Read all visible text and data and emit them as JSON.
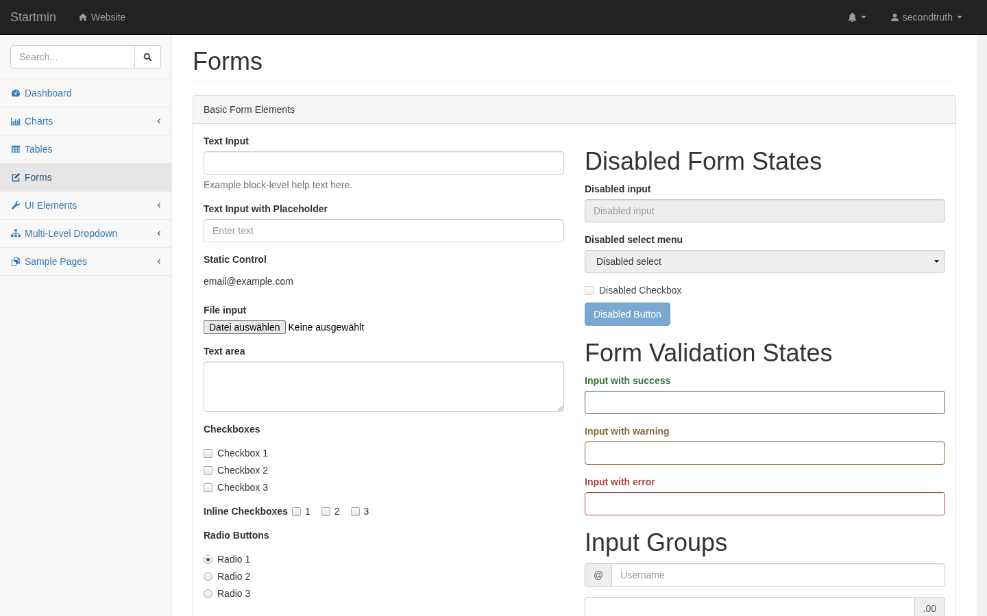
{
  "navbar": {
    "brand": "Startmin",
    "links": [
      {
        "label": "Website"
      }
    ],
    "user": {
      "name": "secondtruth"
    }
  },
  "sidebar": {
    "search": {
      "placeholder": "Search..."
    },
    "items": [
      {
        "label": "Dashboard",
        "selected": false,
        "has_submenu": false
      },
      {
        "label": "Charts",
        "selected": false,
        "has_submenu": true
      },
      {
        "label": "Tables",
        "selected": false,
        "has_submenu": false
      },
      {
        "label": "Forms",
        "selected": true,
        "has_submenu": false
      },
      {
        "label": "UI Elements",
        "selected": false,
        "has_submenu": true
      },
      {
        "label": "Multi-Level Dropdown",
        "selected": false,
        "has_submenu": true
      },
      {
        "label": "Sample Pages",
        "selected": false,
        "has_submenu": true
      }
    ]
  },
  "page": {
    "title": "Forms"
  },
  "panel": {
    "heading": "Basic Form Elements",
    "left": [
      {
        "kind": "text",
        "label": "Text Input",
        "help": "Example block-level help text here."
      },
      {
        "kind": "text",
        "label": "Text Input with Placeholder",
        "placeholder": "Enter text"
      },
      {
        "kind": "static",
        "label": "Static Control",
        "value": "email@example.com"
      },
      {
        "kind": "file",
        "label": "File input",
        "button": "Datei auswählen",
        "status": "Keine ausgewählt"
      },
      {
        "kind": "textarea",
        "label": "Text area"
      },
      {
        "kind": "checkboxes",
        "label": "Checkboxes",
        "options": [
          {
            "label": "Checkbox 1",
            "checked": false
          },
          {
            "label": "Checkbox 2",
            "checked": false
          },
          {
            "label": "Checkbox 3",
            "checked": false
          }
        ]
      },
      {
        "kind": "inline-checkboxes",
        "label": "Inline Checkboxes",
        "options": [
          {
            "label": "1",
            "checked": false
          },
          {
            "label": "2",
            "checked": false
          },
          {
            "label": "3",
            "checked": false
          }
        ]
      },
      {
        "kind": "radios",
        "label": "Radio Buttons",
        "options": [
          {
            "label": "Radio 1",
            "selected": true
          },
          {
            "label": "Radio 2",
            "selected": false
          },
          {
            "label": "Radio 3",
            "selected": false
          }
        ]
      }
    ],
    "right": [
      {
        "kind": "heading",
        "text": "Disabled Form States"
      },
      {
        "kind": "text",
        "label": "Disabled input",
        "placeholder": "Disabled input",
        "disabled": true
      },
      {
        "kind": "select",
        "label": "Disabled select menu",
        "value": "Disabled select",
        "disabled": true
      },
      {
        "kind": "checkbox",
        "label": "Disabled Checkbox",
        "checked": false,
        "disabled": true
      },
      {
        "kind": "button",
        "label": "Disabled Button",
        "disabled": true
      },
      {
        "kind": "heading",
        "text": "Form Validation States"
      },
      {
        "kind": "success",
        "label": "Input with success"
      },
      {
        "kind": "warning",
        "label": "Input with warning"
      },
      {
        "kind": "error",
        "label": "Input with error"
      },
      {
        "kind": "heading",
        "text": "Input Groups"
      },
      {
        "kind": "prepend-group",
        "addon": "@",
        "placeholder": "Username"
      },
      {
        "kind": "append-group",
        "addon": ".00"
      }
    ]
  }
}
